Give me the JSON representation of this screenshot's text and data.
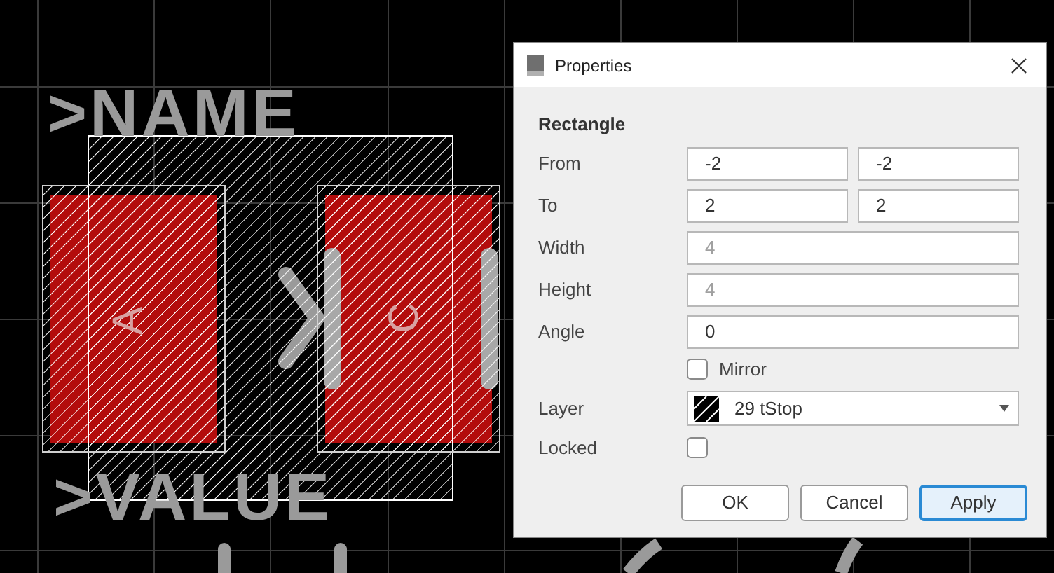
{
  "canvas": {
    "labels": [
      {
        "kind": "name",
        "text": ">NAME"
      },
      {
        "kind": "value",
        "text": ">VALUE"
      },
      {
        "kind": "anode",
        "text": "A"
      },
      {
        "kind": "cathode",
        "text": "C"
      }
    ]
  },
  "dialog": {
    "title": "Properties",
    "heading": "Rectangle",
    "rows": [
      {
        "kind": "pair",
        "label": "From",
        "fields": [
          {
            "value": "-2",
            "disabled": false
          },
          {
            "value": "-2",
            "disabled": false
          }
        ]
      },
      {
        "kind": "pair",
        "label": "To",
        "fields": [
          {
            "value": "2",
            "disabled": false
          },
          {
            "value": "2",
            "disabled": false
          }
        ]
      },
      {
        "kind": "single",
        "label": "Width",
        "fields": [
          {
            "value": "4",
            "disabled": true
          }
        ]
      },
      {
        "kind": "single",
        "label": "Height",
        "fields": [
          {
            "value": "4",
            "disabled": true
          }
        ]
      },
      {
        "kind": "single",
        "label": "Angle",
        "fields": [
          {
            "value": "0",
            "disabled": false
          }
        ]
      },
      {
        "kind": "checkbox",
        "label": "Mirror",
        "checked": false
      },
      {
        "kind": "select",
        "label": "Layer",
        "value": "29 tStop"
      },
      {
        "kind": "locked",
        "label": "Locked",
        "checked": false
      }
    ],
    "buttons": [
      {
        "label": "OK",
        "default": false
      },
      {
        "label": "Cancel",
        "default": false
      },
      {
        "label": "Apply",
        "default": true
      }
    ]
  }
}
